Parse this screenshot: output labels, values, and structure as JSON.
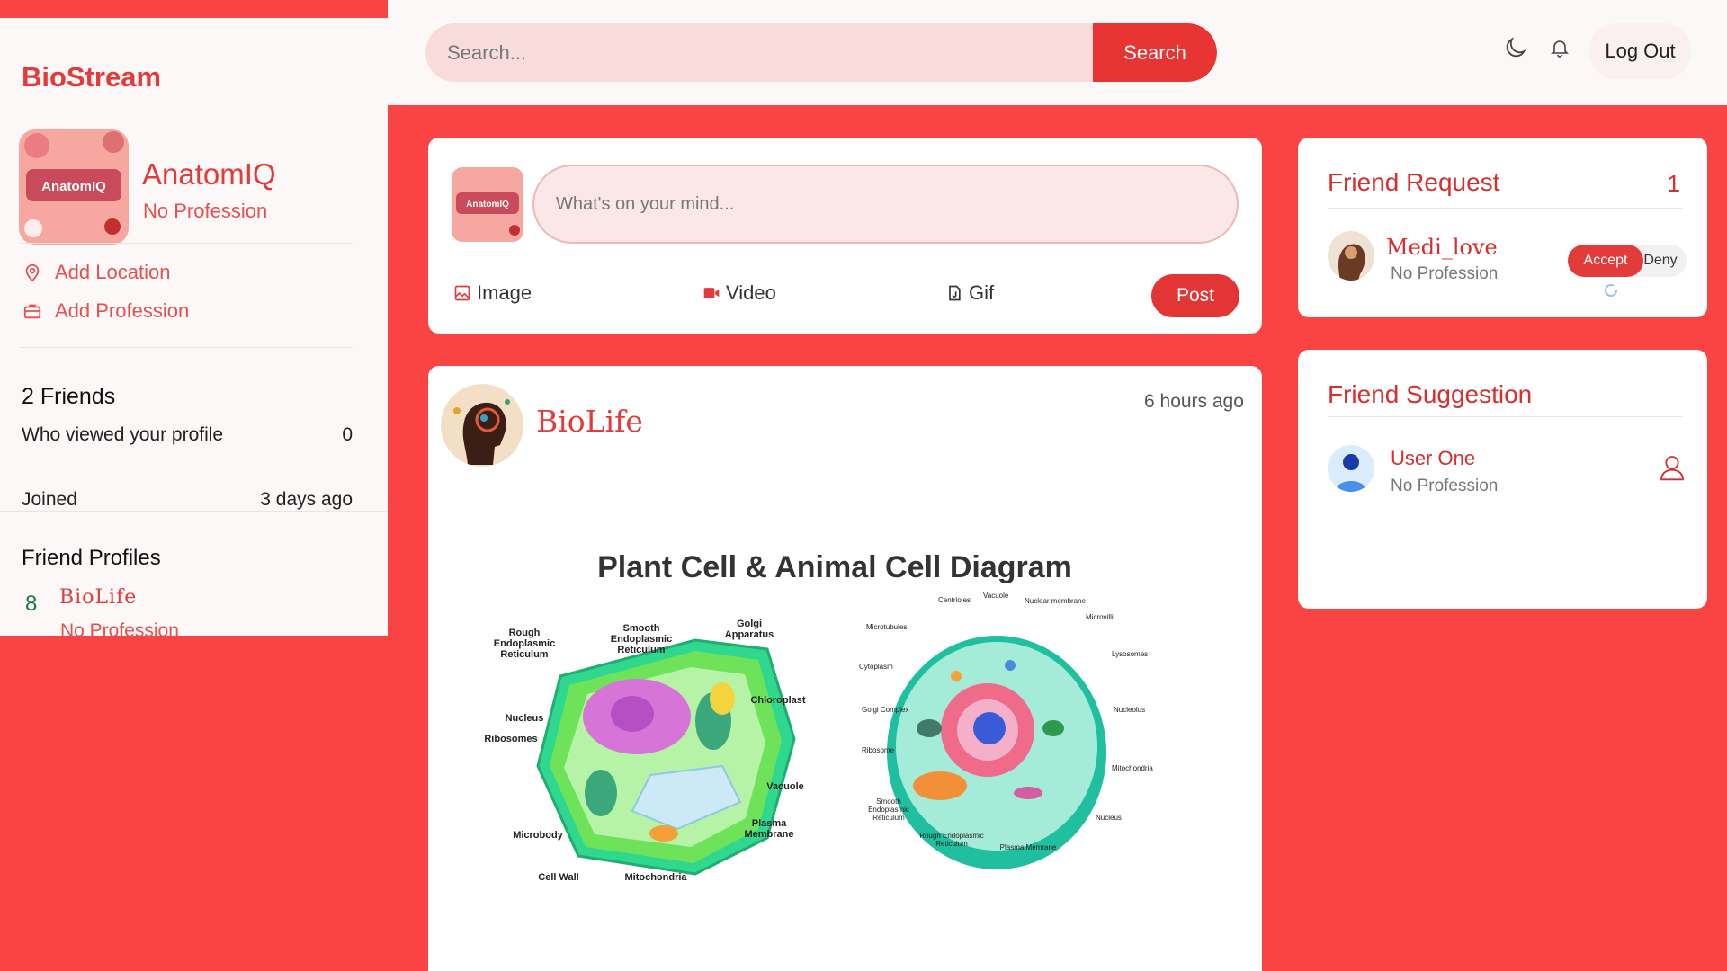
{
  "app": {
    "brand": "BioStream"
  },
  "header": {
    "search_placeholder": "Search...",
    "search_button": "Search",
    "logout": "Log Out",
    "icons": [
      "moon-icon",
      "bell-icon"
    ]
  },
  "sidebar": {
    "profile": {
      "name": "AnatomIQ",
      "profession": "No Profession",
      "avatar_text": "AnatomIQ"
    },
    "links": [
      {
        "label": "Add Location",
        "icon": "location-pin-icon"
      },
      {
        "label": "Add Profession",
        "icon": "briefcase-icon"
      }
    ],
    "friends_count": "2 Friends",
    "viewed_label": "Who viewed your profile",
    "viewed_value": "0",
    "joined_label": "Joined",
    "joined_value": "3 days ago",
    "friend_profiles_title": "Friend Profiles",
    "friend_profiles": [
      {
        "badge": "8",
        "name": "BioLife",
        "profession": "No Profession"
      }
    ]
  },
  "composer": {
    "placeholder": "What's on your mind...",
    "actions": [
      {
        "label": "Image",
        "icon": "image-icon"
      },
      {
        "label": "Video",
        "icon": "video-icon"
      },
      {
        "label": "Gif",
        "icon": "gif-icon"
      }
    ],
    "post_button": "Post"
  },
  "post": {
    "author": "BioLife",
    "time": "6 hours ago",
    "image": {
      "title": "Plant Cell & Animal Cell Diagram",
      "plant_labels": [
        "Rough Endoplasmic Reticulum",
        "Smooth Endoplasmic Reticulum",
        "Golgi Apparatus",
        "Chloroplast",
        "Nucleus",
        "Ribosomes",
        "Vacuole",
        "Plasma Membrane",
        "Microbody",
        "Cell Wall",
        "Mitochondria"
      ],
      "animal_labels": [
        "Centrioles",
        "Vacuole",
        "Nuclear membrane",
        "Microvilli",
        "Microtubules",
        "Lysosomes",
        "Cytoplasm",
        "Nucleolus",
        "Golgi Complex",
        "Ribosome",
        "Mitochondria",
        "Smooth Endoplasmic Reticulum",
        "Rough Endoplasmic Reticulum",
        "Plasma Memrane",
        "Nucleus"
      ]
    }
  },
  "friend_request": {
    "title": "Friend Request",
    "count": "1",
    "items": [
      {
        "name": "Medi_love",
        "profession": "No Profession",
        "accept": "Accept",
        "deny": "Deny"
      }
    ]
  },
  "friend_suggestion": {
    "title": "Friend Suggestion",
    "items": [
      {
        "name": "User One",
        "profession": "No Profession"
      }
    ]
  },
  "colors": {
    "accent": "#e53a3a",
    "background": "#fa4343",
    "panel": "#fdf8f8"
  }
}
